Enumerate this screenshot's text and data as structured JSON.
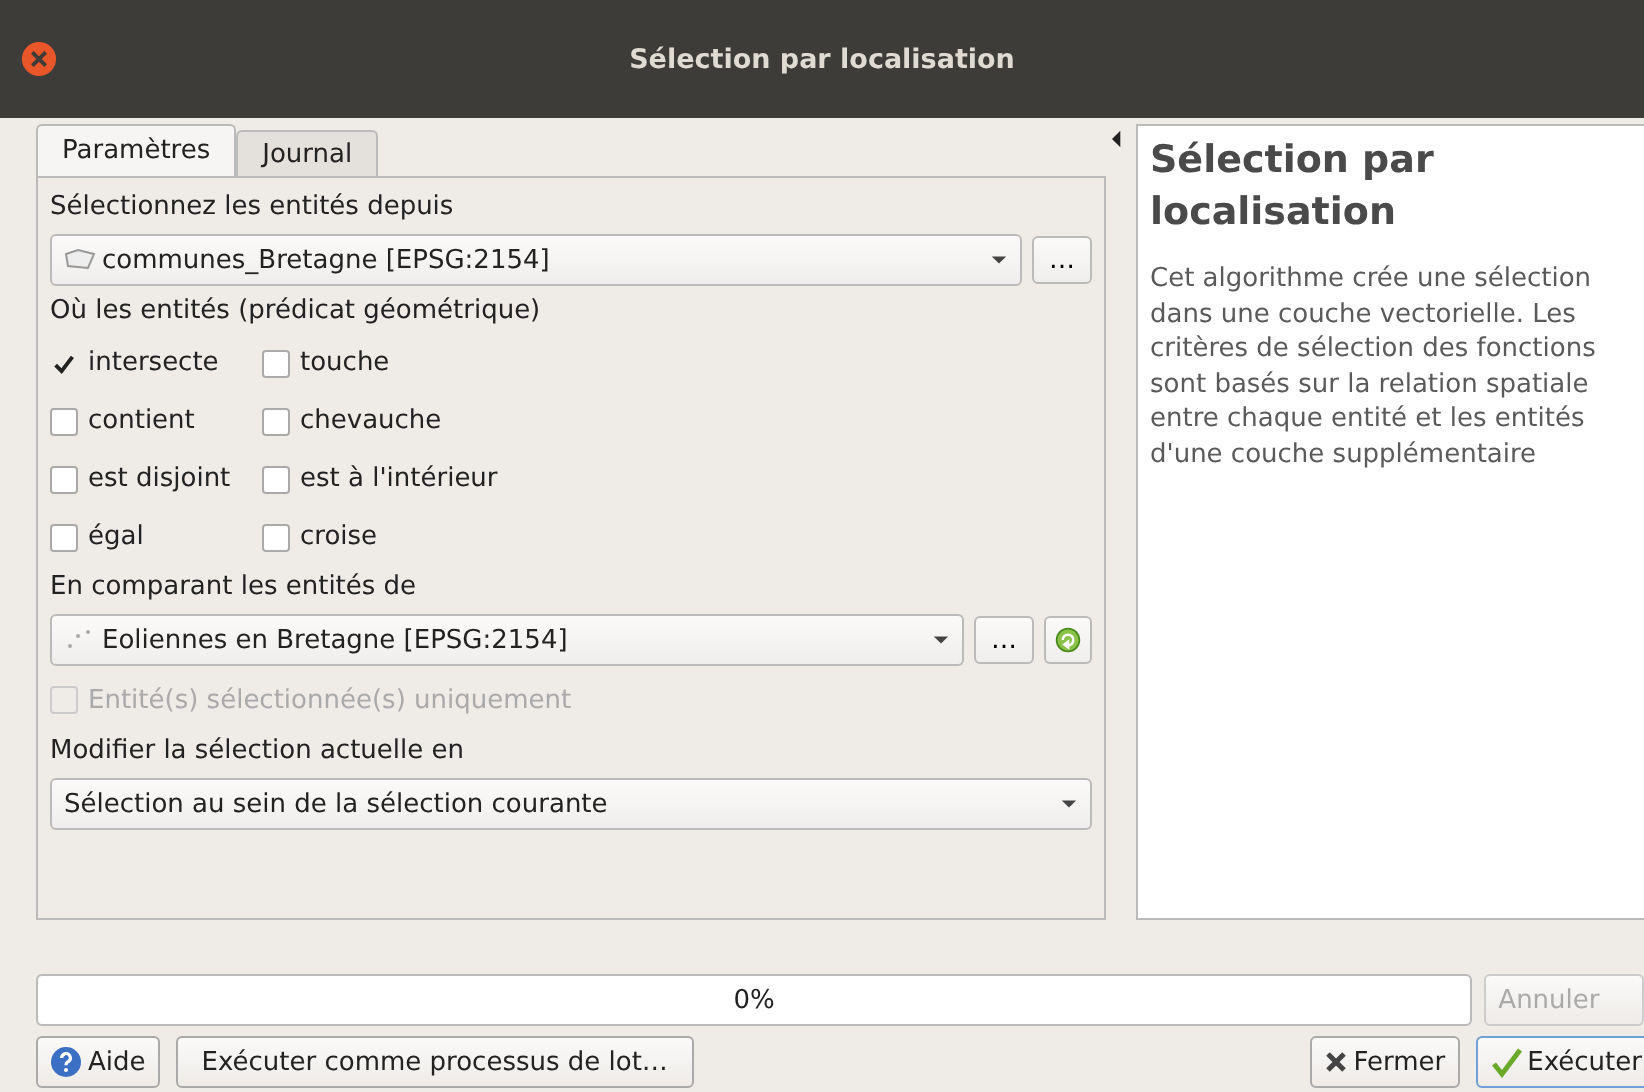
{
  "window": {
    "title": "Sélection par localisation"
  },
  "tabs": [
    {
      "label": "Paramètres",
      "selected": true
    },
    {
      "label": "Journal",
      "selected": false
    }
  ],
  "input_layer": {
    "label": "Sélectionnez les entités depuis",
    "value": "communes_Bretagne [EPSG:2154]",
    "browse": "…"
  },
  "predicates": {
    "label": "Où les entités (prédicat géométrique)",
    "items": [
      {
        "label": "intersecte",
        "checked": true
      },
      {
        "label": "touche",
        "checked": false
      },
      {
        "label": "contient",
        "checked": false
      },
      {
        "label": "chevauche",
        "checked": false
      },
      {
        "label": "est disjoint",
        "checked": false
      },
      {
        "label": "est à l'intérieur",
        "checked": false
      },
      {
        "label": "égal",
        "checked": false
      },
      {
        "label": "croise",
        "checked": false
      }
    ]
  },
  "compare_layer": {
    "label": "En comparant les entités de",
    "value": "Eoliennes en Bretagne [EPSG:2154]",
    "browse": "…"
  },
  "selected_only": {
    "label": "Entité(s) sélectionnée(s) uniquement",
    "checked": false,
    "disabled": true
  },
  "modify": {
    "label": "Modifier la sélection actuelle en",
    "value": "Sélection au sein de la sélection courante"
  },
  "help": {
    "title": "Sélection par localisation",
    "text": "Cet algorithme crée une sélection dans une couche vectorielle. Les critères de sélection des fonctions sont basés sur la relation spatiale entre chaque entité et les entités d'une couche supplémentaire"
  },
  "progress": {
    "level": 0,
    "reading": "0%",
    "cancel": "Annuler",
    "cancel_disabled": true
  },
  "buttons": {
    "help": "Aide",
    "batch": "Exécuter comme processus de lot…",
    "close": "Fermer",
    "run": "Exécuter"
  }
}
